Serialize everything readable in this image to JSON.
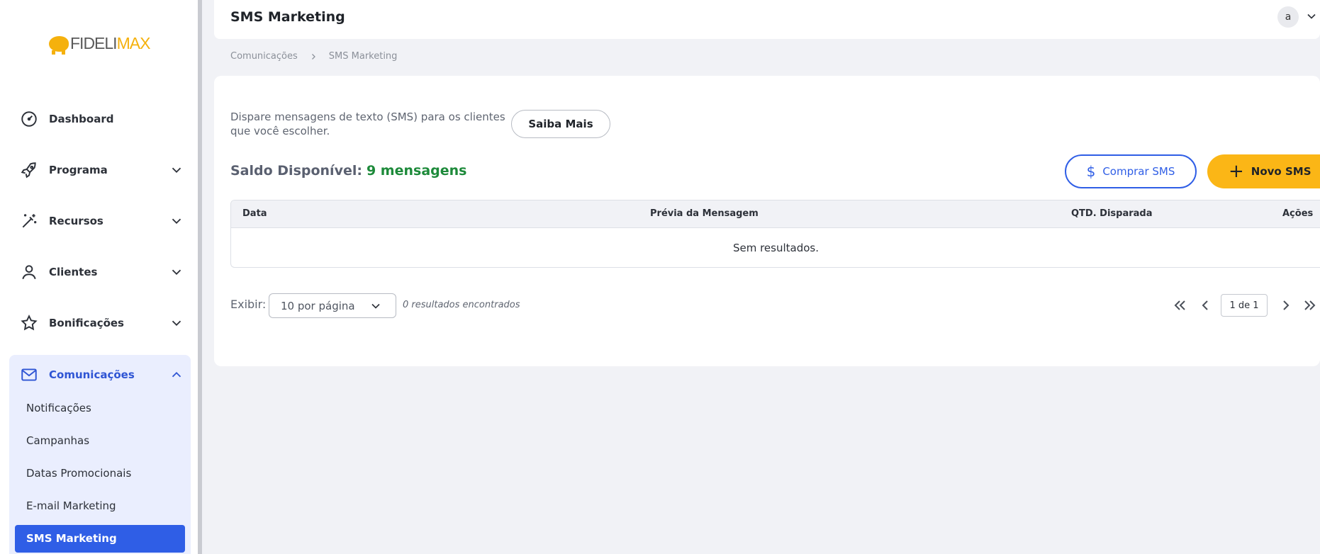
{
  "brand": {
    "logo_part1": "FIDELI",
    "logo_part2": "MAX",
    "accent": "#f5b10d",
    "primary": "#2f5ee6"
  },
  "sidebar": {
    "items": [
      {
        "label": "Dashboard",
        "icon": "gauge-icon"
      },
      {
        "label": "Programa",
        "icon": "rocket-icon"
      },
      {
        "label": "Recursos",
        "icon": "magic-wand-icon"
      },
      {
        "label": "Clientes",
        "icon": "user-icon"
      },
      {
        "label": "Bonificações",
        "icon": "star-icon"
      },
      {
        "label": "Comunicações",
        "icon": "mail-icon"
      }
    ],
    "sub_items": [
      "Notificações",
      "Campanhas",
      "Datas Promocionais",
      "E-mail Marketing",
      "SMS Marketing"
    ]
  },
  "header": {
    "title": "SMS Marketing",
    "avatar": "a"
  },
  "breadcrumb": [
    "Comunicações",
    "SMS Marketing"
  ],
  "main": {
    "description": "Dispare mensagens de texto (SMS) para os clientes que você escolher.",
    "saiba_mais": "Saiba Mais",
    "saldo_label": "Saldo Disponível:",
    "saldo_value": "9 mensagens",
    "comprar_label": "Comprar SMS",
    "novo_label": "Novo SMS",
    "table": {
      "columns": [
        "Data",
        "Prévia da Mensagem",
        "QTD. Disparada",
        "Ações"
      ],
      "empty": "Sem resultados."
    },
    "pagination": {
      "exibir_label": "Exibir:",
      "per_page": "10 por página",
      "results": "0 resultados encontrados",
      "page": "1 de 1"
    }
  }
}
